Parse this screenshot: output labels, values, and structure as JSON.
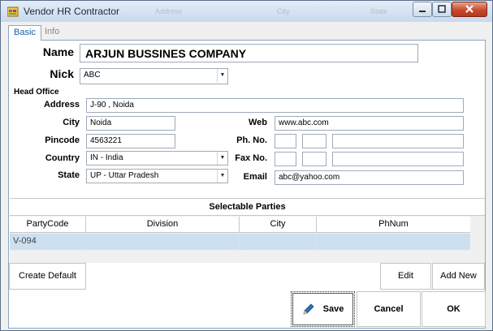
{
  "window": {
    "title": "Vendor HR Contractor",
    "ghost_labels": [
      "Address",
      "City",
      "State"
    ]
  },
  "tabs": [
    {
      "label": "Basic",
      "active": true
    },
    {
      "label": "Info",
      "active": false
    }
  ],
  "form": {
    "name_label": "Name",
    "name_value": "ARJUN BUSSINES COMPANY",
    "nick_label": "Nick",
    "nick_value": "ABC",
    "section_head_office": "Head Office",
    "address_label": "Address",
    "address_value": "J-90 , Noida",
    "city_label": "City",
    "city_value": "Noida",
    "pincode_label": "Pincode",
    "pincode_value": "4563221",
    "country_label": "Country",
    "country_value": "IN - India",
    "state_label": "State",
    "state_value": "UP - Uttar Pradesh",
    "web_label": "Web",
    "web_value": "www.abc.com",
    "phone_label": "Ph. No.",
    "phone_values": [
      "",
      "",
      ""
    ],
    "fax_label": "Fax No.",
    "fax_values": [
      "",
      "",
      ""
    ],
    "email_label": "Email",
    "email_value": "abc@yahoo.com"
  },
  "grid": {
    "caption": "Selectable Parties",
    "columns": [
      "PartyCode",
      "Division",
      "City",
      "PhNum"
    ],
    "rows": [
      [
        "V-094",
        "",
        "",
        ""
      ]
    ]
  },
  "buttons": {
    "create_default": "Create Default",
    "edit": "Edit",
    "add_new": "Add New",
    "save": "Save",
    "cancel": "Cancel",
    "ok": "OK"
  },
  "icons": {
    "app": "window-app-icon",
    "save": "pencil-icon"
  }
}
